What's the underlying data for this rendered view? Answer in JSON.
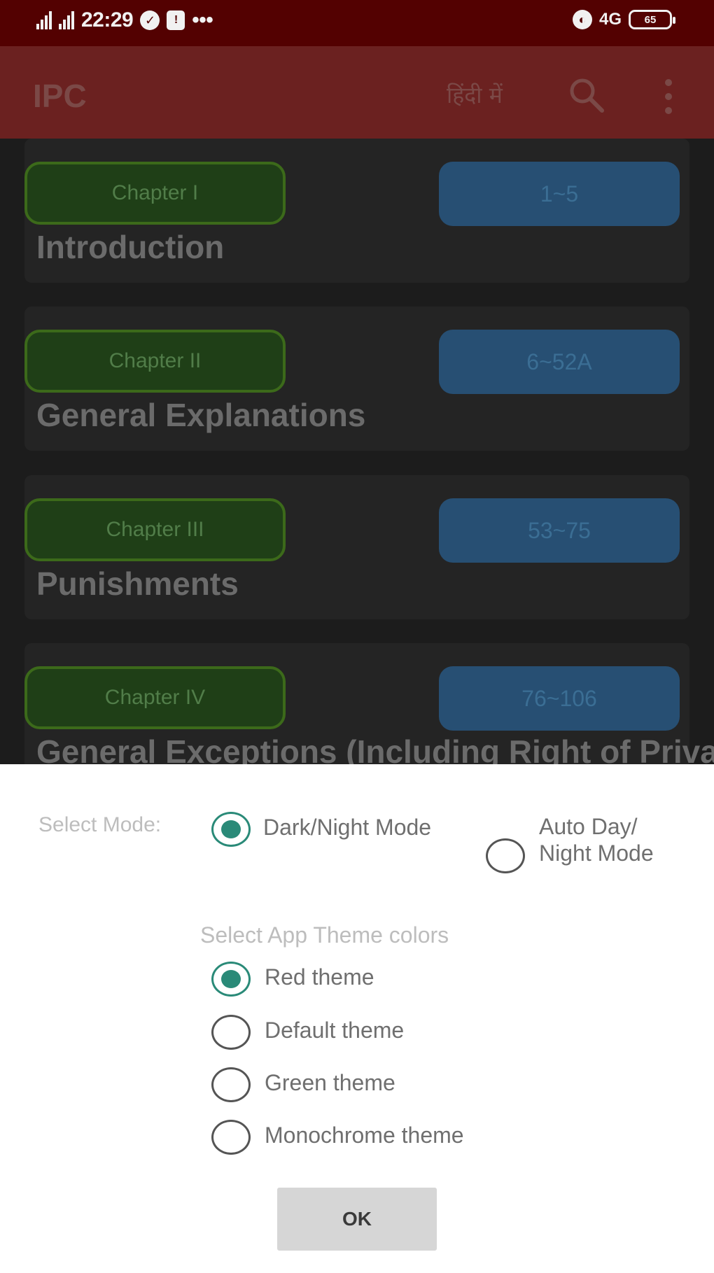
{
  "status_bar": {
    "time": "22:29",
    "network": "4G",
    "battery_text": "65",
    "more": "•••"
  },
  "toolbar": {
    "title": "IPC",
    "language": "हिंदी में",
    "search_icon": "search-icon",
    "more_icon": "more-vert-icon"
  },
  "chapters": [
    {
      "chapter": "Chapter I",
      "range": "1~5",
      "title": "Introduction"
    },
    {
      "chapter": "Chapter II",
      "range": "6~52A",
      "title": "General Explanations"
    },
    {
      "chapter": "Chapter III",
      "range": "53~75",
      "title": "Punishments"
    },
    {
      "chapter": "Chapter IV",
      "range": "76~106",
      "title": "General Exceptions (Including Right of Private Defence)"
    }
  ],
  "dialog": {
    "mode_label": "Select Mode:",
    "modes": [
      {
        "label": "Dark/Night Mode",
        "checked": true
      },
      {
        "label": "Auto Day/ Night Mode",
        "checked": false
      }
    ],
    "theme_heading": "Select App Theme colors",
    "themes": [
      {
        "label": "Red theme",
        "checked": true
      },
      {
        "label": "Default theme",
        "checked": false
      },
      {
        "label": "Green theme",
        "checked": false
      },
      {
        "label": "Monochrome theme",
        "checked": false
      }
    ],
    "ok_label": "OK"
  },
  "colors": {
    "status_bar": "#530101",
    "toolbar": "#6b2120",
    "chapter_button": "#1f3f17",
    "range_button": "#274f73",
    "radio_accent": "#2a8a78"
  }
}
